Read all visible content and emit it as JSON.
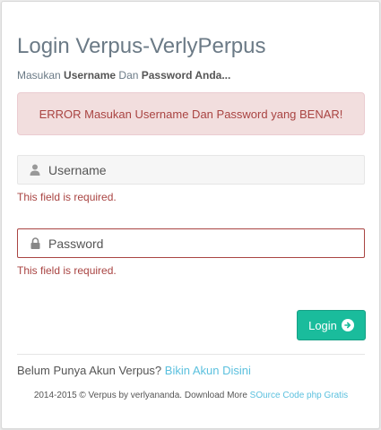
{
  "login": {
    "title": "Login Verpus-VerlyPerpus",
    "subtitle": {
      "part1": "Masukan ",
      "bold1": "Username",
      "part2": " Dan ",
      "bold2": "Password Anda..."
    },
    "alert": "ERROR Masukan Username Dan Password yang BENAR!",
    "username": {
      "placeholder": "Username",
      "icon": "user-icon",
      "error": "This field is required."
    },
    "password": {
      "placeholder": "Password",
      "icon": "lock-icon",
      "error": "This field is required."
    },
    "submit_label": "Login",
    "submit_icon": "arrow-circle-right-icon"
  },
  "register": {
    "text": "Belum Punya Akun Verpus? ",
    "link": "Bikin Akun Disini"
  },
  "footer": {
    "text": "2014-2015 © Verpus by verlyananda. Download More ",
    "link": "SOurce Code php Gratis"
  },
  "colors": {
    "accent": "#1abc9c",
    "error": "#a94442",
    "alert_bg": "#f2dede",
    "link": "#5bc0de"
  }
}
